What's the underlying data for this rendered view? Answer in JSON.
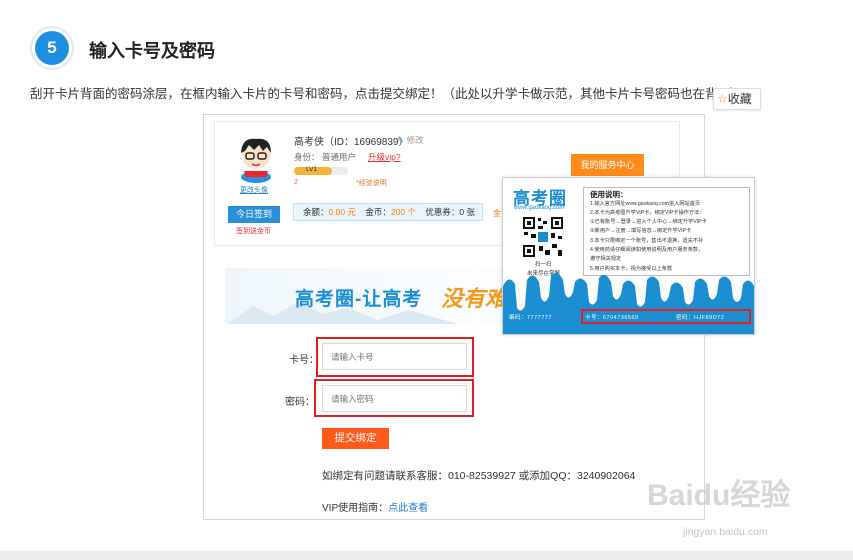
{
  "step": {
    "number": "5",
    "title": "输入卡号及密码"
  },
  "description": "刮开卡片背面的密码涂层，在框内输入卡片的卡号和密码，点击提交绑定！（此处以升学卡做示范，其他卡片卡号密码也在背面）",
  "favorite_label": "收藏",
  "profile": {
    "username": "高考侠（ID：16969839）",
    "edit_label": "修改",
    "identity": "身份：  普通用户",
    "upgrade_link": "升级vip?",
    "level": "LV1",
    "level_progress": 0.7,
    "level_sub": "2",
    "exp_link": "*经验说明",
    "change_avatar": "更改头像",
    "service_center": "我的服务中心",
    "checkin": "今日签到",
    "checkin_sub": "签到送金币",
    "balance_label": "余额：",
    "balance_value": "0.00 元",
    "coins_label": "金币：",
    "coins_value": "200 个",
    "coupon": "优惠券：0 张",
    "more": "金"
  },
  "banner": {
    "text": "高考圈-让高考",
    "text2": "没有难"
  },
  "form": {
    "card_label": "卡号：",
    "card_placeholder": "请输入卡号",
    "pwd_label": "密码：",
    "pwd_placeholder": "请输入密码",
    "submit": "提交绑定",
    "contact": "如绑定有问题请联系客服：010-82539927 或添加QQ：3240902064",
    "guide_label": "VIP使用指南：",
    "guide_link": "点此查看"
  },
  "card": {
    "logo": "高考圈",
    "url": "www.gaokaoq.com",
    "qr_caption": "扫一扫",
    "qr_caption2": "未来尽在掌握",
    "usage_title": "使用说明：",
    "usage_lines": [
      "1.输入官方网址www.gaokaoq.com进入网站首页",
      "2.本卡为高考圈升学VIP卡，绑定VIP卡操作方法：",
      "  ①已有账号→登录→进入个人中心→绑定升学VIP卡",
      "  ②新用户→注册→填写信息→绑定升学VIP卡",
      "3.本卡只限绑定一个账号，售出不退换，遗失不补",
      "4.使用前请仔细阅读如使用说明及用户服务条款，",
      "  遵守相关规定",
      "5.用户购买本卡，视为接受以上条款"
    ],
    "serial": "编码：7777777",
    "card_number": "卡号：6704736569",
    "password": "密码：HJF89D72"
  },
  "watermark": {
    "text": "Baidu经验",
    "url": "jingyan.baidu.com"
  },
  "colors": {
    "accent_blue": "#1e8fe0",
    "orange": "#ff8c1a",
    "red": "#e02020"
  }
}
